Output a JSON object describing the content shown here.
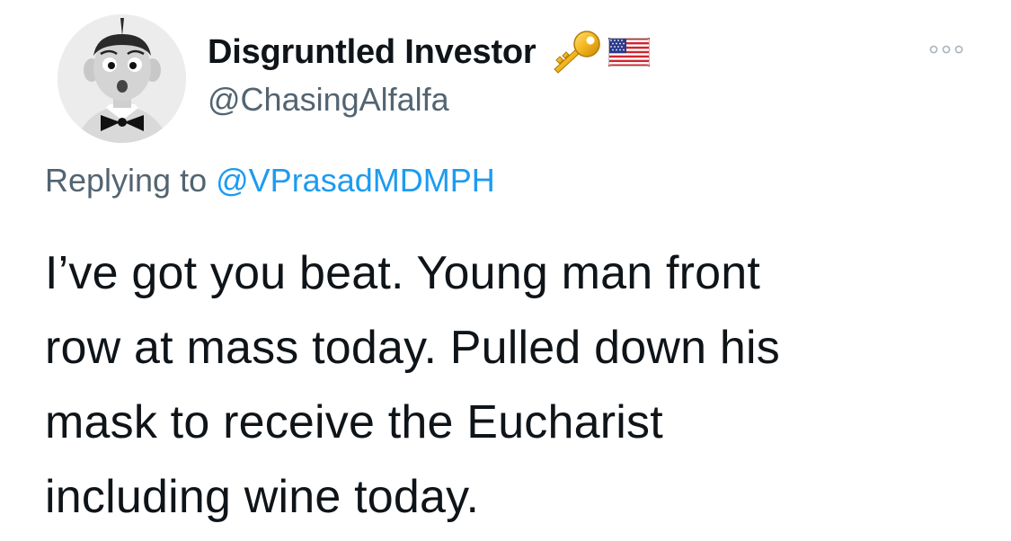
{
  "tweet": {
    "author": {
      "display_name": "Disgruntled Investor",
      "handle": "@ChasingAlfalfa",
      "badges": [
        "key-icon",
        "us-flag-icon"
      ]
    },
    "reply": {
      "prefix": "Replying to",
      "mention": "@VPrasadMDMPH"
    },
    "text_lines": [
      "I’ve got you beat. Young man front",
      "row at mass today. Pulled down his",
      "mask to receive the Eucharist",
      "including wine today."
    ],
    "more_icon": "ellipsis-icon"
  },
  "colors": {
    "primary_text": "#0f1419",
    "secondary_text": "#536471",
    "link": "#1d9bf0",
    "background": "#ffffff"
  }
}
